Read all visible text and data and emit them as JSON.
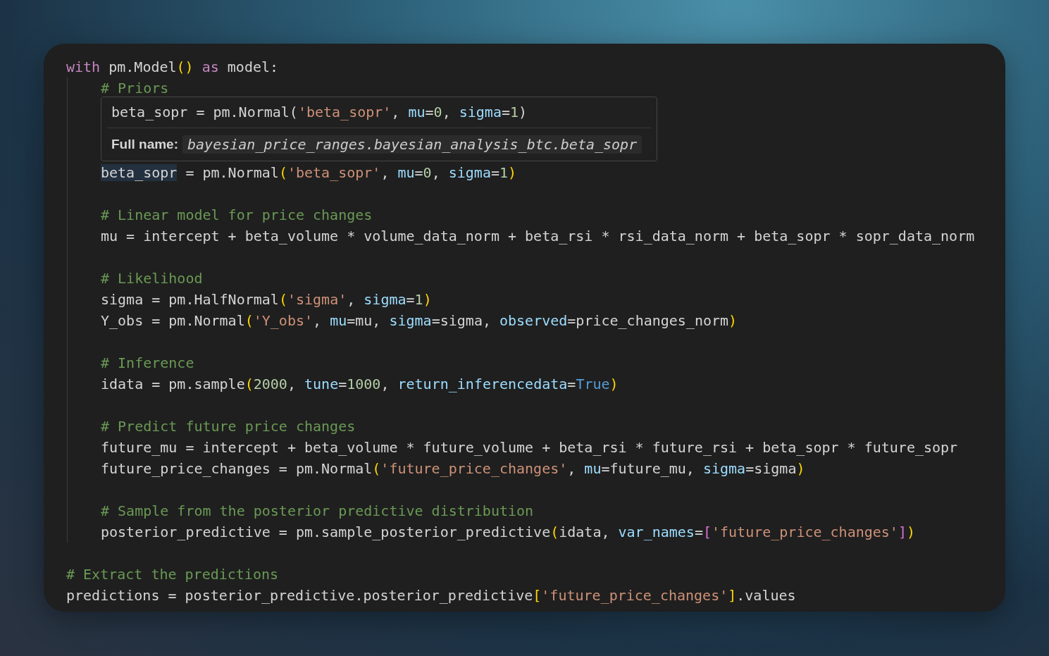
{
  "code": {
    "blocks": [
      {
        "lines": [
          {
            "tokens": [
              {
                "text": "with",
                "kind": "keyword"
              },
              {
                "text": " pm.Model",
                "kind": "plain"
              },
              {
                "text": "()",
                "kind": "paren"
              },
              {
                "text": " as",
                "kind": "keyword"
              },
              {
                "text": " model:",
                "kind": "plain"
              }
            ],
            "children": [
              {
                "lines": [
                  {
                    "tokens": [
                      {
                        "text": "# Priors",
                        "kind": "comment"
                      }
                    ]
                  },
                  {
                    "tooltip": {
                      "signature": [
                        {
                          "text": "beta_sopr = pm.Normal(",
                          "kind": "plain"
                        },
                        {
                          "text": "'beta_sopr'",
                          "kind": "string"
                        },
                        {
                          "text": ", ",
                          "kind": "plain"
                        },
                        {
                          "text": "mu",
                          "kind": "param"
                        },
                        {
                          "text": "=",
                          "kind": "plain"
                        },
                        {
                          "text": "0",
                          "kind": "number"
                        },
                        {
                          "text": ", ",
                          "kind": "plain"
                        },
                        {
                          "text": "sigma",
                          "kind": "param"
                        },
                        {
                          "text": "=",
                          "kind": "plain"
                        },
                        {
                          "text": "1",
                          "kind": "number"
                        },
                        {
                          "text": ")",
                          "kind": "plain"
                        }
                      ],
                      "label": "Full name:",
                      "full_name": "bayesian_price_ranges.bayesian_analysis_btc.beta_sopr"
                    },
                    "tokens": [
                      {
                        "text": "beta_sopr",
                        "kind": "highlight"
                      },
                      {
                        "text": " = pm.Normal",
                        "kind": "plain"
                      },
                      {
                        "text": "(",
                        "kind": "paren"
                      },
                      {
                        "text": "'beta_sopr'",
                        "kind": "string"
                      },
                      {
                        "text": ", ",
                        "kind": "plain"
                      },
                      {
                        "text": "mu",
                        "kind": "param"
                      },
                      {
                        "text": "=",
                        "kind": "plain"
                      },
                      {
                        "text": "0",
                        "kind": "number"
                      },
                      {
                        "text": ", ",
                        "kind": "plain"
                      },
                      {
                        "text": "sigma",
                        "kind": "param"
                      },
                      {
                        "text": "=",
                        "kind": "plain"
                      },
                      {
                        "text": "1",
                        "kind": "number"
                      },
                      {
                        "text": ")",
                        "kind": "paren"
                      }
                    ]
                  }
                ]
              },
              {
                "lines": [
                  {
                    "tokens": [
                      {
                        "text": "# Linear model for price changes",
                        "kind": "comment"
                      }
                    ]
                  },
                  {
                    "tokens": [
                      {
                        "text": "mu = intercept + beta_volume * volume_data_norm + beta_rsi * rsi_data_norm + beta_sopr * sopr_data_norm",
                        "kind": "plain"
                      }
                    ]
                  }
                ]
              },
              {
                "lines": [
                  {
                    "tokens": [
                      {
                        "text": "# Likelihood",
                        "kind": "comment"
                      }
                    ]
                  },
                  {
                    "tokens": [
                      {
                        "text": "sigma = pm.HalfNormal",
                        "kind": "plain"
                      },
                      {
                        "text": "(",
                        "kind": "paren"
                      },
                      {
                        "text": "'sigma'",
                        "kind": "string"
                      },
                      {
                        "text": ", ",
                        "kind": "plain"
                      },
                      {
                        "text": "sigma",
                        "kind": "param"
                      },
                      {
                        "text": "=",
                        "kind": "plain"
                      },
                      {
                        "text": "1",
                        "kind": "number"
                      },
                      {
                        "text": ")",
                        "kind": "paren"
                      }
                    ]
                  },
                  {
                    "tokens": [
                      {
                        "text": "Y_obs = pm.Normal",
                        "kind": "plain"
                      },
                      {
                        "text": "(",
                        "kind": "paren"
                      },
                      {
                        "text": "'Y_obs'",
                        "kind": "string"
                      },
                      {
                        "text": ", ",
                        "kind": "plain"
                      },
                      {
                        "text": "mu",
                        "kind": "param"
                      },
                      {
                        "text": "=mu, ",
                        "kind": "plain"
                      },
                      {
                        "text": "sigma",
                        "kind": "param"
                      },
                      {
                        "text": "=sigma, ",
                        "kind": "plain"
                      },
                      {
                        "text": "observed",
                        "kind": "param"
                      },
                      {
                        "text": "=price_changes_norm",
                        "kind": "plain"
                      },
                      {
                        "text": ")",
                        "kind": "paren"
                      }
                    ]
                  }
                ]
              },
              {
                "lines": [
                  {
                    "tokens": [
                      {
                        "text": "# Inference",
                        "kind": "comment"
                      }
                    ]
                  },
                  {
                    "tokens": [
                      {
                        "text": "idata = pm.sample",
                        "kind": "plain"
                      },
                      {
                        "text": "(",
                        "kind": "paren"
                      },
                      {
                        "text": "2000",
                        "kind": "number"
                      },
                      {
                        "text": ", ",
                        "kind": "plain"
                      },
                      {
                        "text": "tune",
                        "kind": "param"
                      },
                      {
                        "text": "=",
                        "kind": "plain"
                      },
                      {
                        "text": "1000",
                        "kind": "number"
                      },
                      {
                        "text": ", ",
                        "kind": "plain"
                      },
                      {
                        "text": "return_inferencedata",
                        "kind": "param"
                      },
                      {
                        "text": "=",
                        "kind": "plain"
                      },
                      {
                        "text": "True",
                        "kind": "constant"
                      },
                      {
                        "text": ")",
                        "kind": "paren"
                      }
                    ]
                  }
                ]
              },
              {
                "lines": [
                  {
                    "tokens": [
                      {
                        "text": "# Predict future price changes",
                        "kind": "comment"
                      }
                    ]
                  },
                  {
                    "tokens": [
                      {
                        "text": "future_mu = intercept + beta_volume * future_volume + beta_rsi * future_rsi + beta_sopr * future_sopr",
                        "kind": "plain"
                      }
                    ]
                  },
                  {
                    "tokens": [
                      {
                        "text": "future_price_changes = pm.Normal",
                        "kind": "plain"
                      },
                      {
                        "text": "(",
                        "kind": "paren"
                      },
                      {
                        "text": "'future_price_changes'",
                        "kind": "string"
                      },
                      {
                        "text": ", ",
                        "kind": "plain"
                      },
                      {
                        "text": "mu",
                        "kind": "param"
                      },
                      {
                        "text": "=future_mu, ",
                        "kind": "plain"
                      },
                      {
                        "text": "sigma",
                        "kind": "param"
                      },
                      {
                        "text": "=sigma",
                        "kind": "plain"
                      },
                      {
                        "text": ")",
                        "kind": "paren"
                      }
                    ]
                  }
                ]
              },
              {
                "lines": [
                  {
                    "tokens": [
                      {
                        "text": "# Sample from the posterior predictive distribution",
                        "kind": "comment"
                      }
                    ]
                  },
                  {
                    "tokens": [
                      {
                        "text": "posterior_predictive = pm.sample_posterior_predictive",
                        "kind": "plain"
                      },
                      {
                        "text": "(",
                        "kind": "paren"
                      },
                      {
                        "text": "idata, ",
                        "kind": "plain"
                      },
                      {
                        "text": "var_names",
                        "kind": "param"
                      },
                      {
                        "text": "=",
                        "kind": "plain"
                      },
                      {
                        "text": "[",
                        "kind": "bracket"
                      },
                      {
                        "text": "'future_price_changes'",
                        "kind": "string"
                      },
                      {
                        "text": "]",
                        "kind": "bracket"
                      },
                      {
                        "text": ")",
                        "kind": "paren"
                      }
                    ]
                  }
                ]
              }
            ]
          }
        ]
      },
      {
        "lines": [
          {
            "tokens": [
              {
                "text": "# Extract the predictions",
                "kind": "comment"
              }
            ]
          },
          {
            "tokens": [
              {
                "text": "predictions = posterior_predictive.posterior_predictive",
                "kind": "plain"
              },
              {
                "text": "[",
                "kind": "paren"
              },
              {
                "text": "'future_price_changes'",
                "kind": "string"
              },
              {
                "text": "]",
                "kind": "paren"
              },
              {
                "text": ".values",
                "kind": "plain"
              }
            ]
          }
        ]
      }
    ]
  }
}
